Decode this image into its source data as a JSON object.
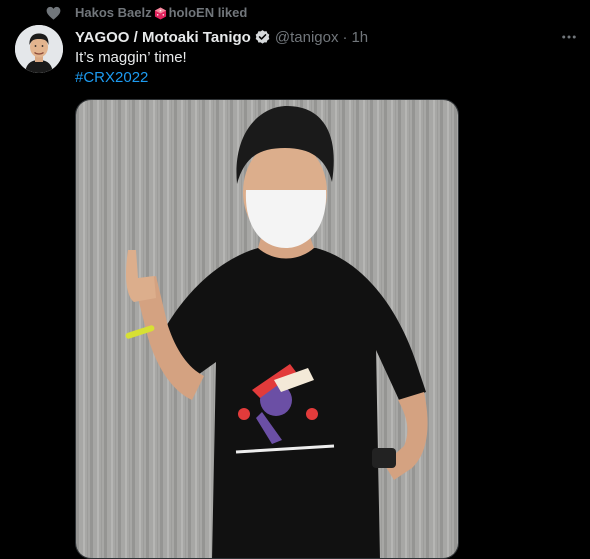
{
  "social_context": {
    "liker_name": "Hakos Baelz",
    "suffix": "holoEN liked",
    "icon": "heart-icon"
  },
  "tweet": {
    "author_name": "YAGOO / Motoaki Tanigo",
    "verified": true,
    "handle": "@tanigox",
    "separator": "·",
    "timestamp": "1h",
    "text": "It’s maggin’ time!",
    "hashtag": "#CRX2022",
    "more_icon": "more-horizontal-icon"
  },
  "colors": {
    "background": "#000000",
    "text": "#e7e9ea",
    "secondary": "#71767b",
    "link": "#1d9bf0"
  }
}
